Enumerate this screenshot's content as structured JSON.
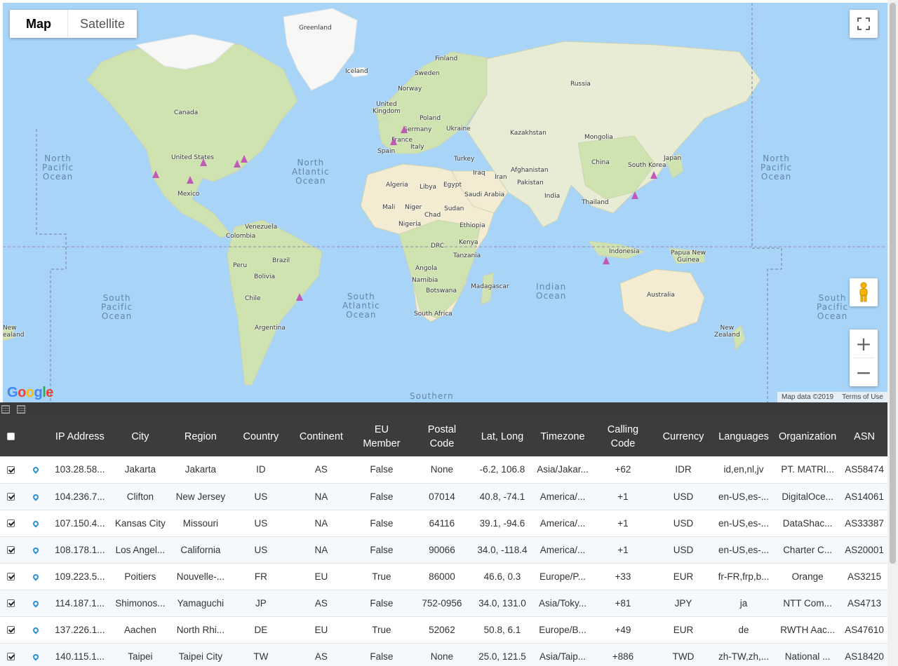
{
  "map": {
    "type_buttons": [
      "Map",
      "Satellite"
    ],
    "active_type": "Map",
    "logo": "Google",
    "attribution": "Map data ©2019",
    "terms": "Terms of Use",
    "oceans": {
      "north_pacific_w": "North\nPacific\nOcean",
      "north_atlantic": "North\nAtlantic\nOcean",
      "north_pacific_e": "North\nPacific\nOcean",
      "south_pacific_w": "South\nPacific\nOcean",
      "south_atlantic": "South\nAtlantic\nOcean",
      "indian": "Indian\nOcean",
      "south_pacific_e": "South\nPacific\nOcean",
      "southern": "Southern"
    },
    "places": {
      "greenland": "Greenland",
      "iceland": "Iceland",
      "finland": "Finland",
      "sweden": "Sweden",
      "norway": "Norway",
      "russia": "Russia",
      "uk": "United\nKingdom",
      "poland": "Poland",
      "germany": "Germany",
      "ukraine": "Ukraine",
      "france": "France",
      "italy": "Italy",
      "spain": "Spain",
      "kazakhstan": "Kazakhstan",
      "mongolia": "Mongolia",
      "turkey": "Turkey",
      "china": "China",
      "south_korea": "South Korea",
      "japan": "Japan",
      "iraq": "Iraq",
      "iran": "Iran",
      "afghanistan": "Afghanistan",
      "pakistan": "Pakistan",
      "algeria": "Algeria",
      "libya": "Libya",
      "egypt": "Egypt",
      "saudi": "Saudi Arabia",
      "india": "India",
      "thailand": "Thailand",
      "mali": "Mali",
      "niger": "Niger",
      "chad": "Chad",
      "sudan": "Sudan",
      "nigeria": "Nigeria",
      "ethiopia": "Ethiopia",
      "kenya": "Kenya",
      "drc": "DRC",
      "tanzania": "Tanzania",
      "indonesia": "Indonesia",
      "png": "Papua New\nGuinea",
      "angola": "Angola",
      "namibia": "Namibia",
      "botswana": "Botswana",
      "madagascar": "Madagascar",
      "south_africa": "South Africa",
      "australia": "Australia",
      "new_zealand": "New\nZealand",
      "nz_w": "New\nealand",
      "canada": "Canada",
      "united_states": "United States",
      "mexico": "Mexico",
      "venezuela": "Venezuela",
      "colombia": "Colombia",
      "peru": "Peru",
      "brazil": "Brazil",
      "bolivia": "Bolivia",
      "chile": "Chile",
      "argentina": "Argentina"
    }
  },
  "table": {
    "headers": [
      "",
      "",
      "IP Address",
      "City",
      "Region",
      "Country",
      "Continent",
      "EU\nMember",
      "Postal\nCode",
      "Lat, Long",
      "Timezone",
      "Calling\nCode",
      "Currency",
      "Languages",
      "Organization",
      "ASN"
    ],
    "rows": [
      [
        "103.28.58...",
        "Jakarta",
        "Jakarta",
        "ID",
        "AS",
        "False",
        "None",
        "-6.2, 106.8",
        "Asia/Jakar...",
        "+62",
        "IDR",
        "id,en,nl,jv",
        "PT. MATRI...",
        "AS58474"
      ],
      [
        "104.236.7...",
        "Clifton",
        "New Jersey",
        "US",
        "NA",
        "False",
        "07014",
        "40.8, -74.1",
        "America/...",
        "+1",
        "USD",
        "en-US,es-...",
        "DigitalOce...",
        "AS14061"
      ],
      [
        "107.150.4...",
        "Kansas City",
        "Missouri",
        "US",
        "NA",
        "False",
        "64116",
        "39.1, -94.6",
        "America/...",
        "+1",
        "USD",
        "en-US,es-...",
        "DataShac...",
        "AS33387"
      ],
      [
        "108.178.1...",
        "Los Angel...",
        "California",
        "US",
        "NA",
        "False",
        "90066",
        "34.0, -118.4",
        "America/...",
        "+1",
        "USD",
        "en-US,es-...",
        "Charter C...",
        "AS20001"
      ],
      [
        "109.223.5...",
        "Poitiers",
        "Nouvelle-...",
        "FR",
        "EU",
        "True",
        "86000",
        "46.6, 0.3",
        "Europe/P...",
        "+33",
        "EUR",
        "fr-FR,frp,b...",
        "Orange",
        "AS3215"
      ],
      [
        "114.187.1...",
        "Shimonos...",
        "Yamaguchi",
        "JP",
        "AS",
        "False",
        "752-0956",
        "34.0, 131.0",
        "Asia/Toky...",
        "+81",
        "JPY",
        "ja",
        "NTT Com...",
        "AS4713"
      ],
      [
        "137.226.1...",
        "Aachen",
        "North Rhi...",
        "DE",
        "EU",
        "True",
        "52062",
        "50.8, 6.1",
        "Europe/B...",
        "+49",
        "EUR",
        "de",
        "RWTH Aac...",
        "AS47610"
      ],
      [
        "140.115.1...",
        "Taipei",
        "Taipei City",
        "TW",
        "AS",
        "False",
        "None",
        "25.0, 121.5",
        "Asia/Taip...",
        "+886",
        "TWD",
        "zh-TW,zh,...",
        "National ...",
        "AS18420"
      ]
    ]
  }
}
